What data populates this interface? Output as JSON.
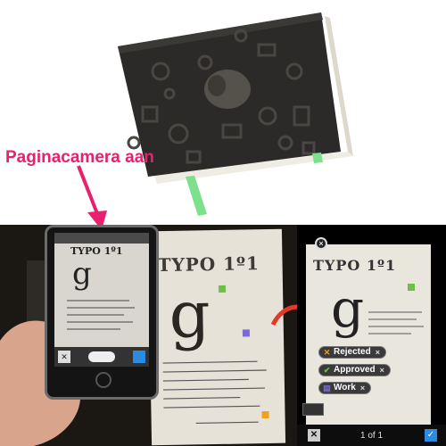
{
  "callout": {
    "text": "Paginacamera aan",
    "color": "#e8206e"
  },
  "phone_preview": {
    "title": "TYPO 1º1",
    "letter": "g",
    "close_label": "✕"
  },
  "notebook_page": {
    "title": "TYPO 1º1",
    "letter": "g"
  },
  "app_screen": {
    "close_label": "×",
    "title": "TYPO 1º1",
    "letter": "g",
    "tags": [
      {
        "label": "Rejected",
        "icon": "✕",
        "icon_color": "#f0a020",
        "remove": "×"
      },
      {
        "label": "Approved",
        "icon": "✔",
        "icon_color": "#6cc04a",
        "remove": "×"
      },
      {
        "label": "Work",
        "icon": "▤",
        "icon_color": "#7a6ad8",
        "remove": "×"
      }
    ],
    "trash_label": "✕",
    "page_count": "1 of 1",
    "confirm_label": "✓"
  },
  "colors": {
    "accent_blue": "#2a8be0",
    "notebook_cover": "#2b2a28",
    "ribbon_green": "#7de08c"
  }
}
